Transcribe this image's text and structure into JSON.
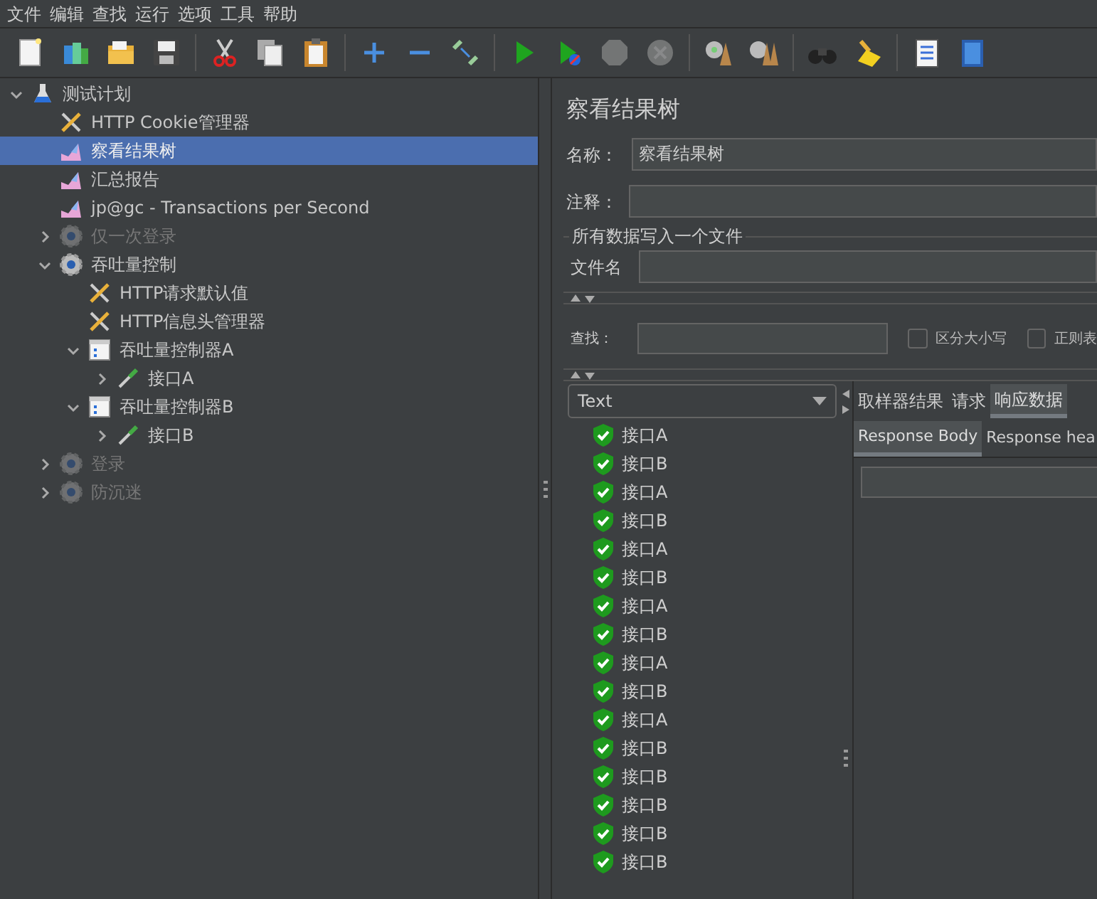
{
  "menu": [
    "文件",
    "编辑",
    "查找",
    "运行",
    "选项",
    "工具",
    "帮助"
  ],
  "toolbar": [
    [
      {
        "kind": "new",
        "disabled": false
      },
      {
        "kind": "templates",
        "disabled": false
      },
      {
        "kind": "open",
        "disabled": false
      },
      {
        "kind": "save",
        "disabled": false
      }
    ],
    [
      {
        "kind": "cut",
        "disabled": false
      },
      {
        "kind": "copy",
        "disabled": false
      },
      {
        "kind": "paste",
        "disabled": false
      }
    ],
    [
      {
        "kind": "expand",
        "disabled": false
      },
      {
        "kind": "collapse",
        "disabled": false
      },
      {
        "kind": "toggle",
        "disabled": false
      }
    ],
    [
      {
        "kind": "start",
        "disabled": false
      },
      {
        "kind": "start-no-pause",
        "disabled": false
      },
      {
        "kind": "stop",
        "disabled": true
      },
      {
        "kind": "shutdown",
        "disabled": true
      }
    ],
    [
      {
        "kind": "clear",
        "disabled": false
      },
      {
        "kind": "clear-all",
        "disabled": false
      }
    ],
    [
      {
        "kind": "search",
        "disabled": false
      },
      {
        "kind": "reset-search",
        "disabled": false
      }
    ],
    [
      {
        "kind": "log",
        "disabled": false
      },
      {
        "kind": "help",
        "disabled": false
      }
    ]
  ],
  "tree": [
    {
      "label": "测试计划",
      "kind": "plan",
      "expanded": true,
      "selected": false,
      "disabled": false,
      "children": [
        {
          "label": "HTTP Cookie管理器",
          "kind": "config",
          "selected": false,
          "disabled": false
        },
        {
          "label": "察看结果树",
          "kind": "listener",
          "selected": true,
          "disabled": false
        },
        {
          "label": "汇总报告",
          "kind": "listener",
          "selected": false,
          "disabled": false
        },
        {
          "label": "jp@gc - Transactions per Second",
          "kind": "listener",
          "selected": false,
          "disabled": false
        },
        {
          "label": "仅一次登录",
          "kind": "group",
          "expanded": false,
          "selected": false,
          "disabled": true
        },
        {
          "label": "吞吐量控制",
          "kind": "group",
          "expanded": true,
          "selected": false,
          "disabled": false,
          "children": [
            {
              "label": "HTTP请求默认值",
              "kind": "config",
              "selected": false,
              "disabled": false
            },
            {
              "label": "HTTP信息头管理器",
              "kind": "config",
              "selected": false,
              "disabled": false
            },
            {
              "label": "吞吐量控制器A",
              "kind": "controller",
              "expanded": true,
              "selected": false,
              "disabled": false,
              "children": [
                {
                  "label": "接口A",
                  "kind": "sampler",
                  "expanded": false,
                  "selected": false,
                  "disabled": false
                }
              ]
            },
            {
              "label": "吞吐量控制器B",
              "kind": "controller",
              "expanded": true,
              "selected": false,
              "disabled": false,
              "children": [
                {
                  "label": "接口B",
                  "kind": "sampler",
                  "expanded": false,
                  "selected": false,
                  "disabled": false
                }
              ]
            }
          ]
        },
        {
          "label": "登录",
          "kind": "group",
          "expanded": false,
          "selected": false,
          "disabled": true
        },
        {
          "label": "防沉迷",
          "kind": "group",
          "expanded": false,
          "selected": false,
          "disabled": true
        }
      ]
    }
  ],
  "panel": {
    "title": "察看结果树",
    "name": {
      "label": "名称：",
      "value": "察看结果树"
    },
    "comment": {
      "label": "注释："
    },
    "file_group": {
      "title": "所有数据写入一个文件",
      "label": "文件名"
    },
    "search": {
      "label": "查找：",
      "options": [
        {
          "label": "区分大小写",
          "checked": false
        },
        {
          "label": "正则表",
          "checked": false
        }
      ]
    },
    "renderer": "Text",
    "results": [
      {
        "label": "接口A",
        "success": true
      },
      {
        "label": "接口B",
        "success": true
      },
      {
        "label": "接口A",
        "success": true
      },
      {
        "label": "接口B",
        "success": true
      },
      {
        "label": "接口A",
        "success": true
      },
      {
        "label": "接口B",
        "success": true
      },
      {
        "label": "接口A",
        "success": true
      },
      {
        "label": "接口B",
        "success": true
      },
      {
        "label": "接口A",
        "success": true
      },
      {
        "label": "接口B",
        "success": true
      },
      {
        "label": "接口A",
        "success": true
      },
      {
        "label": "接口B",
        "success": true
      },
      {
        "label": "接口B",
        "success": true
      },
      {
        "label": "接口B",
        "success": true
      },
      {
        "label": "接口B",
        "success": true
      },
      {
        "label": "接口B",
        "success": true
      }
    ],
    "tabs": [
      {
        "label": "取样器结果",
        "selected": false
      },
      {
        "label": "请求",
        "selected": false
      },
      {
        "label": "响应数据",
        "selected": true
      }
    ],
    "subtabs": [
      {
        "label": "Response Body",
        "selected": true
      },
      {
        "label": "Response hea",
        "selected": false
      }
    ]
  }
}
